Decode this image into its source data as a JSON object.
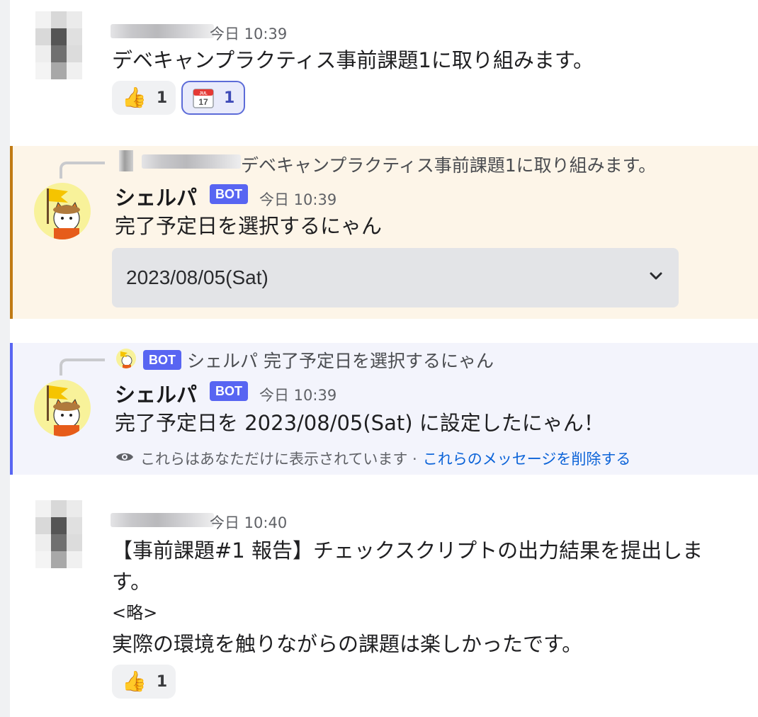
{
  "messages": [
    {
      "time": "今日 10:39",
      "text": "デベキャンプラクティス事前課題1に取り組みます。",
      "reactions": [
        {
          "emoji": "👍",
          "count": "1",
          "icon": "thumbs-up"
        },
        {
          "emoji": "📅",
          "count": "1",
          "icon": "calendar",
          "calendar_month": "JUL",
          "calendar_day": "17"
        }
      ]
    },
    {
      "reply_text": "デベキャンプラクティス事前課題1に取り組みます。",
      "bot_name": "シェルパ",
      "badge": "BOT",
      "time": "今日 10:39",
      "text": "完了予定日を選択するにゃん",
      "select_value": "2023/08/05(Sat)",
      "accent_color": "#c07a13",
      "bg_color": "#fdf5e8"
    },
    {
      "reply_badge": "BOT",
      "reply_text": "シェルパ 完了予定日を選択するにゃん",
      "bot_name": "シェルパ",
      "badge": "BOT",
      "time": "今日 10:39",
      "text": "完了予定日を 2023/08/05(Sat) に設定したにゃん！",
      "notice_text": "これらはあなただけに表示されています ·",
      "notice_link": "これらのメッセージを削除する",
      "accent_color": "#5865f2",
      "bg_color": "#f3f4fc"
    },
    {
      "time": "今日 10:40",
      "line1": "【事前課題#1 報告】チェックスクリプトの出力結果を提出しま",
      "line2": "す。",
      "line3": "<略>",
      "line4": "実際の環境を触りながらの課題は楽しかったです。",
      "reactions": [
        {
          "emoji": "👍",
          "count": "1",
          "icon": "thumbs-up"
        }
      ]
    }
  ]
}
